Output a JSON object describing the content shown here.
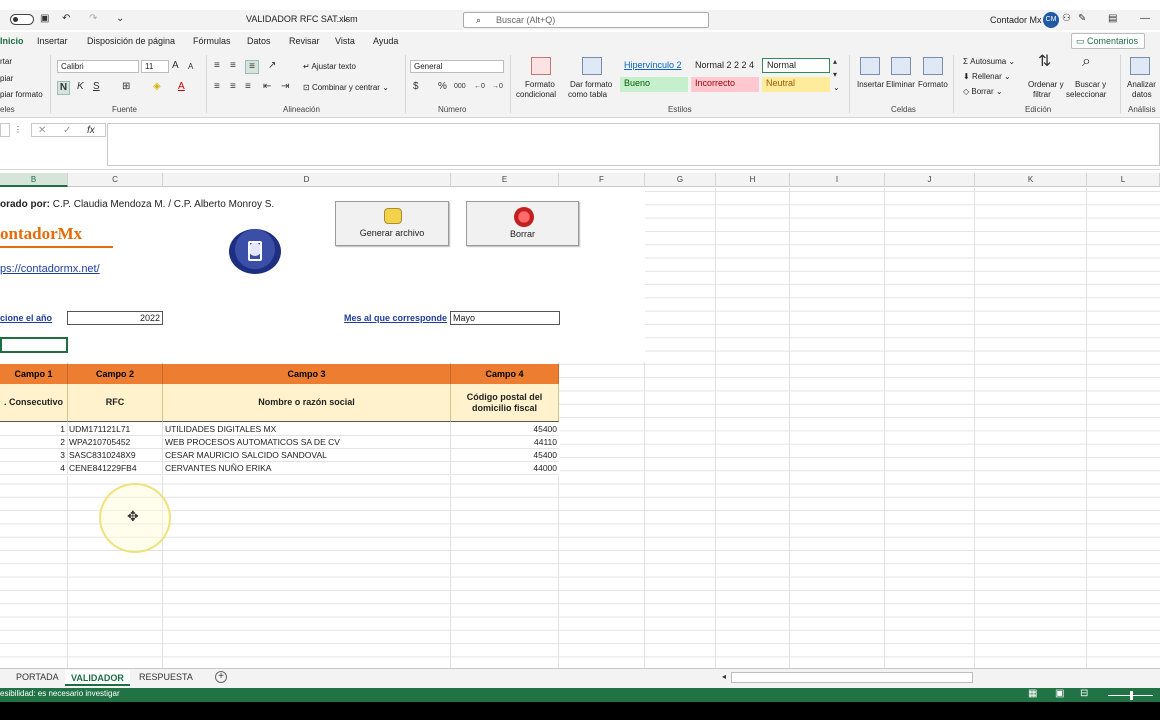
{
  "window": {
    "filename": "VALIDADOR RFC SAT.xlsm",
    "search_placeholder": "Buscar (Alt+Q)",
    "user_name": "Contador Mx",
    "user_initials": "CM"
  },
  "tabs": [
    "Inicio",
    "Insertar",
    "Disposición de página",
    "Fórmulas",
    "Datos",
    "Revisar",
    "Vista",
    "Ayuda"
  ],
  "comments_label": "Comentarios",
  "ribbon": {
    "clipboard": {
      "cut": "rtar",
      "copy": "piar",
      "format_painter": "piar formato",
      "label": "eles"
    },
    "font": {
      "name": "Calibri",
      "size": "11",
      "label": "Fuente"
    },
    "alignment": {
      "wrap": "Ajustar texto",
      "merge": "Combinar y centrar",
      "label": "Alineación"
    },
    "number": {
      "format": "General",
      "label": "Número"
    },
    "styles": {
      "cond_format": [
        "Formato",
        "condicional"
      ],
      "table_format": [
        "Dar formato",
        "como tabla"
      ],
      "cells": [
        "Hipervínculo 2",
        "Normal 2 2 2 4",
        "Normal",
        "Bueno",
        "Incorrecto",
        "Neutral"
      ],
      "label": "Estilos"
    },
    "cells": {
      "insert": "Insertar",
      "delete": "Eliminar",
      "format": "Formato",
      "label": "Celdas"
    },
    "editing": {
      "autosum": "Autosuma",
      "fill": "Rellenar",
      "clear": "Borrar",
      "sort": [
        "Ordenar y",
        "filtrar"
      ],
      "find": [
        "Buscar y",
        "seleccionar"
      ],
      "label": "Edición"
    },
    "analysis": {
      "analyze": [
        "Analizar",
        "datos"
      ],
      "label": "Análisis"
    }
  },
  "columns": [
    "B",
    "C",
    "D",
    "E",
    "F",
    "G",
    "H",
    "I",
    "J",
    "K",
    "L"
  ],
  "sheet": {
    "author_bold": "orado por:",
    "author_rest": "C.P. Claudia Mendoza M. / C.P. Alberto Monroy S.",
    "logo_text": "ontadorMx",
    "url": "ps://contadormx.net/",
    "btn_generate": "Generar archivo",
    "btn_delete": "Borrar",
    "year_label": "cione el año",
    "year_value": "2022",
    "month_label": "Mes al que corresponde",
    "month_value": "Mayo",
    "table": {
      "campos": [
        "Campo 1",
        "Campo 2",
        "Campo 3",
        "Campo 4"
      ],
      "headers": [
        ". Consecutivo",
        "RFC",
        "Nombre o razón social",
        "Código postal del domicilio fiscal"
      ],
      "rows": [
        {
          "n": "1",
          "rfc": "UDM171121L71",
          "name": "UTILIDADES DIGITALES MX",
          "cp": "45400"
        },
        {
          "n": "2",
          "rfc": "WPA210705452",
          "name": "WEB PROCESOS AUTOMATICOS SA DE CV",
          "cp": "44110"
        },
        {
          "n": "3",
          "rfc": "SASC8310248X9",
          "name": "CESAR MAURICIO SALCIDO SANDOVAL",
          "cp": "45400"
        },
        {
          "n": "4",
          "rfc": "CENE841229FB4",
          "name": "CERVANTES NUÑO ERIKA",
          "cp": "44000"
        }
      ]
    }
  },
  "sheet_tabs": [
    "PORTADA",
    "VALIDADOR",
    "RESPUESTA"
  ],
  "status_text": "esibilidad: es necesario investigar",
  "colors": {
    "excel_green": "#217346",
    "header_orange": "#ed7d31",
    "header_cream": "#fff2cc"
  }
}
